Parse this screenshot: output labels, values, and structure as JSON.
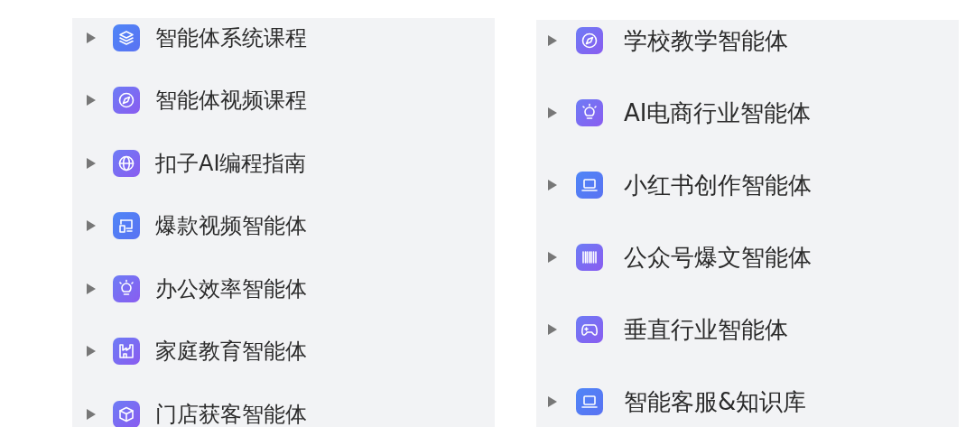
{
  "columns": [
    {
      "items": [
        {
          "label": "智能体系统课程",
          "kind": "layers",
          "expanded": false
        },
        {
          "label": "智能体视频课程",
          "kind": "compass",
          "expanded": false
        },
        {
          "label": "扣子AI编程指南",
          "kind": "globe",
          "expanded": false
        },
        {
          "label": "爆款视频智能体",
          "kind": "screen",
          "expanded": false
        },
        {
          "label": "办公效率智能体",
          "kind": "bulb",
          "expanded": false
        },
        {
          "label": "家庭教育智能体",
          "kind": "factory",
          "expanded": false
        },
        {
          "label": "门店获客智能体",
          "kind": "cube",
          "expanded": false
        }
      ]
    },
    {
      "items": [
        {
          "label": "学校教学智能体",
          "kind": "compass",
          "expanded": false
        },
        {
          "label": "AI电商行业智能体",
          "kind": "bulb",
          "expanded": false
        },
        {
          "label": "小红书创作智能体",
          "kind": "laptop",
          "expanded": false
        },
        {
          "label": "公众号爆文智能体",
          "kind": "barcode",
          "expanded": false
        },
        {
          "label": "垂直行业智能体",
          "kind": "gamepad",
          "expanded": false
        },
        {
          "label": "智能客服&知识库",
          "kind": "laptop",
          "expanded": false
        }
      ]
    }
  ]
}
